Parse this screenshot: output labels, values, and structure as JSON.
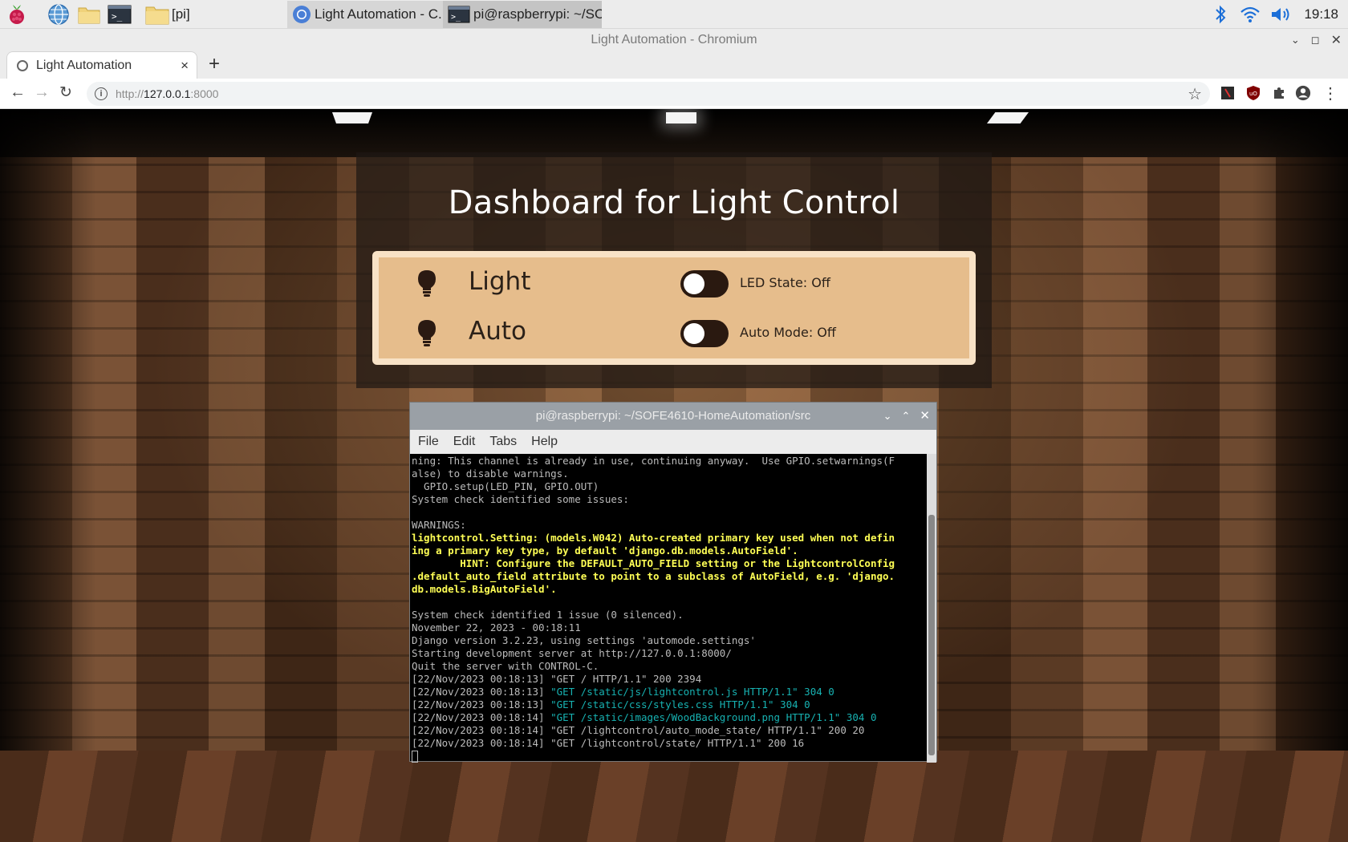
{
  "taskbar": {
    "folder_label": "[pi]",
    "task_browser": "Light Automation - C...",
    "task_terminal": "pi@raspberrypi: ~/SO...",
    "clock": "19:18"
  },
  "browser": {
    "window_title": "Light Automation - Chromium",
    "tab_title": "Light Automation",
    "tab_close": "×",
    "new_tab": "+",
    "url_protocol": "http://",
    "url_host": "127.0.0.1",
    "url_port": ":8000"
  },
  "dashboard": {
    "title": "Dashboard for Light Control",
    "rows": [
      {
        "label": "Light",
        "state": "LED State: Off",
        "on": false
      },
      {
        "label": "Auto",
        "state": "Auto Mode: Off",
        "on": false
      }
    ],
    "card_color": "#e6bd8c",
    "toggle_color": "#2a1910"
  },
  "terminal": {
    "title": "pi@raspberrypi: ~/SOFE4610-HomeAutomation/src",
    "menu": [
      "File",
      "Edit",
      "Tabs",
      "Help"
    ],
    "lines": [
      {
        "t": "ning: This channel is already in use, continuing anyway.  Use GPIO.setwarnings(F",
        "c": ""
      },
      {
        "t": "alse) to disable warnings.",
        "c": ""
      },
      {
        "t": "  GPIO.setup(LED_PIN, GPIO.OUT)",
        "c": ""
      },
      {
        "t": "System check identified some issues:",
        "c": ""
      },
      {
        "t": "",
        "c": ""
      },
      {
        "t": "WARNINGS:",
        "c": ""
      },
      {
        "t": "lightcontrol.Setting: (models.W042) Auto-created primary key used when not defin",
        "c": "yl"
      },
      {
        "t": "ing a primary key type, by default 'django.db.models.AutoField'.",
        "c": "yl"
      },
      {
        "t": "        HINT: Configure the DEFAULT_AUTO_FIELD setting or the LightcontrolConfig",
        "c": "yl"
      },
      {
        "t": ".default_auto_field attribute to point to a subclass of AutoField, e.g. 'django.",
        "c": "yl"
      },
      {
        "t": "db.models.BigAutoField'.",
        "c": "yl"
      },
      {
        "t": "",
        "c": ""
      },
      {
        "t": "System check identified 1 issue (0 silenced).",
        "c": ""
      },
      {
        "t": "November 22, 2023 - 00:18:11",
        "c": ""
      },
      {
        "t": "Django version 3.2.23, using settings 'automode.settings'",
        "c": ""
      },
      {
        "t": "Starting development server at http://127.0.0.1:8000/",
        "c": ""
      },
      {
        "t": "Quit the server with CONTROL-C.",
        "c": ""
      },
      {
        "t": "[22/Nov/2023 00:18:13] \"GET / HTTP/1.1\" 200 2394",
        "c": ""
      },
      {
        "t": "[22/Nov/2023 00:18:13] ",
        "c": "",
        "cy": "\"GET /static/js/lightcontrol.js HTTP/1.1\" 304 0"
      },
      {
        "t": "[22/Nov/2023 00:18:13] ",
        "c": "",
        "cy": "\"GET /static/css/styles.css HTTP/1.1\" 304 0"
      },
      {
        "t": "[22/Nov/2023 00:18:14] ",
        "c": "",
        "cy": "\"GET /static/images/WoodBackground.png HTTP/1.1\" 304 0"
      },
      {
        "t": "[22/Nov/2023 00:18:14] \"GET /lightcontrol/auto_mode_state/ HTTP/1.1\" 200 20",
        "c": ""
      },
      {
        "t": "[22/Nov/2023 00:18:14] \"GET /lightcontrol/state/ HTTP/1.1\" 200 16",
        "c": ""
      }
    ]
  },
  "icons": {
    "raspberry": "raspberry-menu-icon",
    "globe": "web-browser-icon",
    "files": "file-manager-icon",
    "terminal": "terminal-icon",
    "bluetooth": "bluetooth-icon",
    "wifi": "wifi-icon",
    "volume": "volume-icon",
    "bulb": "lightbulb-icon"
  }
}
